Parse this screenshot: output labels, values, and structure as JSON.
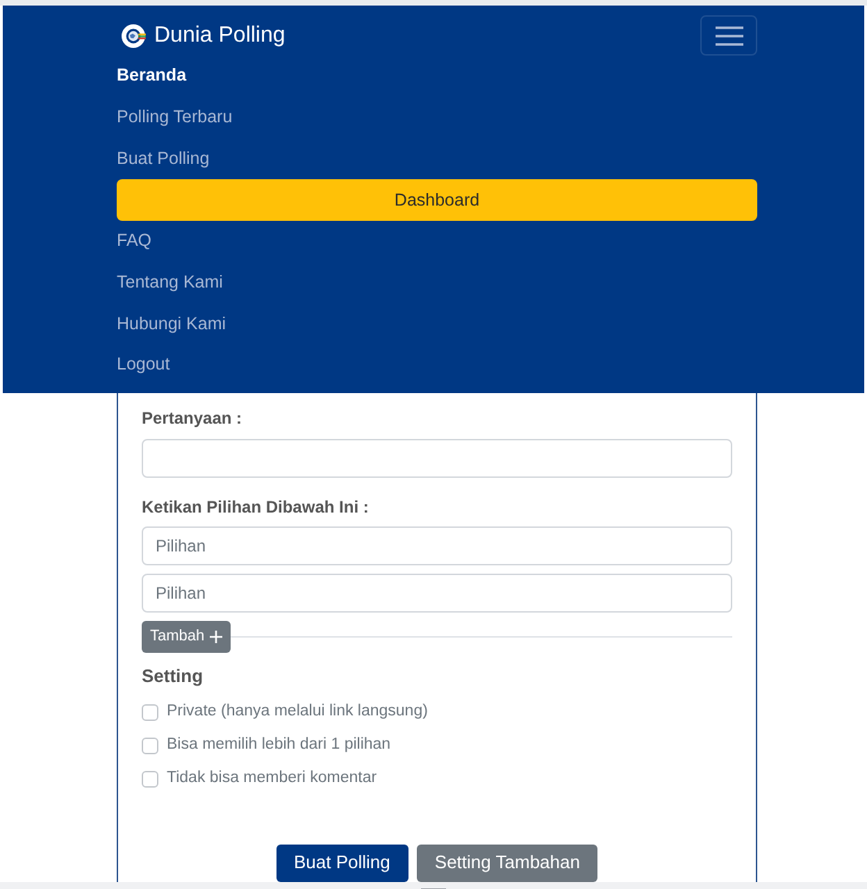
{
  "navbar": {
    "brand": "Dunia Polling",
    "items": [
      {
        "label": "Beranda",
        "kind": "link",
        "selected": true
      },
      {
        "label": "Polling Terbaru",
        "kind": "link",
        "selected": false
      },
      {
        "label": "Buat Polling",
        "kind": "link",
        "selected": false
      },
      {
        "label": "Dashboard",
        "kind": "button",
        "selected": false
      },
      {
        "label": "FAQ",
        "kind": "link",
        "selected": false
      },
      {
        "label": "Tentang Kami",
        "kind": "link",
        "selected": false
      },
      {
        "label": "Hubungi Kami",
        "kind": "link",
        "selected": false
      },
      {
        "label": "Logout",
        "kind": "link",
        "selected": false
      }
    ]
  },
  "form": {
    "question": {
      "label": "Pertanyaan :"
    },
    "choices": {
      "label": "Ketikan Pilihan Dibawah Ini :",
      "fields": [
        {
          "placeholder": "Pilihan"
        },
        {
          "placeholder": "Pilihan"
        }
      ],
      "add_button": "Tambah"
    },
    "settings": {
      "title": "Setting",
      "options": [
        {
          "label": "Private (hanya melalui link langsung)",
          "checked": false
        },
        {
          "label": "Bisa memilih lebih dari 1 pilihan",
          "checked": false
        },
        {
          "label": "Tidak bisa memberi komentar",
          "checked": false
        }
      ]
    },
    "buttons": [
      {
        "label": "Buat Polling",
        "kind": "primary"
      },
      {
        "label": "Setting Tambahan",
        "kind": "secondary"
      }
    ]
  }
}
